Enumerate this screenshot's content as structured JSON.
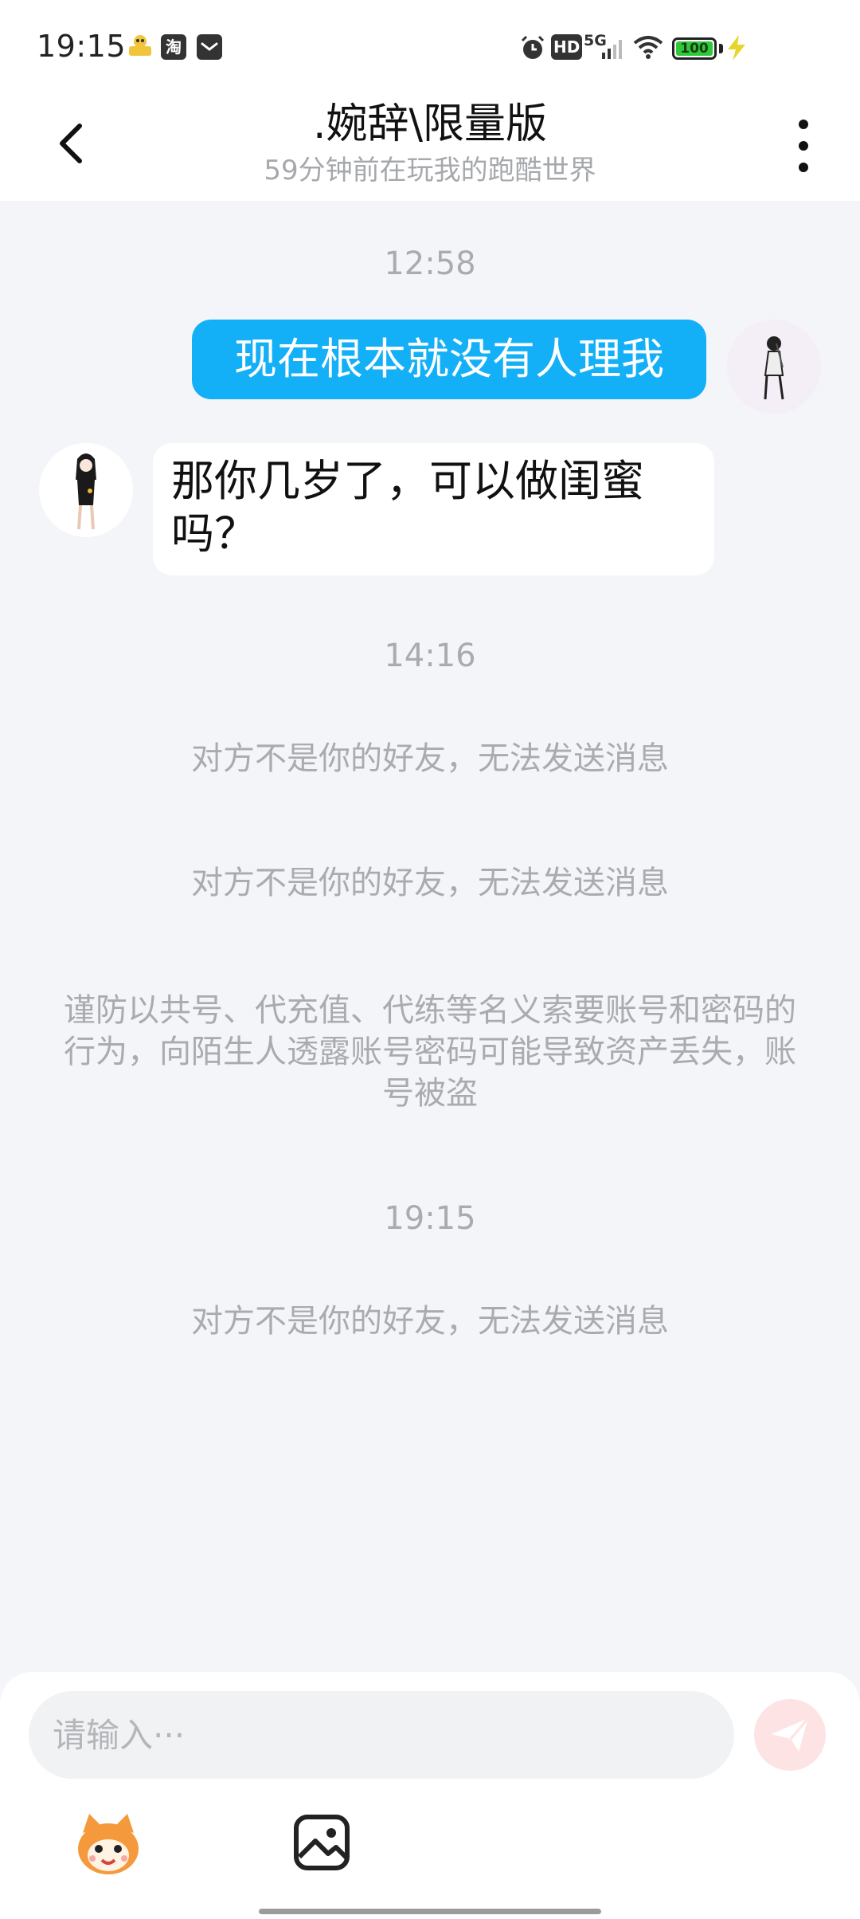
{
  "status_bar": {
    "time": "19:15",
    "network": "5G",
    "battery": "100",
    "icons": [
      "app-mascot-icon",
      "taobao-icon",
      "mail-app-icon",
      "alarm-icon",
      "hd-icon",
      "signal-icon",
      "wifi-icon",
      "battery-icon",
      "charging-icon"
    ]
  },
  "header": {
    "title": ".婉辞\\限量版",
    "subtitle": "59分钟前在玩我的跑酷世界"
  },
  "chat": {
    "time_1": "12:58",
    "outgoing_message": "现在根本就没有人理我",
    "incoming_message": "那你几岁了，可以做闺蜜吗？",
    "time_2": "14:16",
    "system_1": "对方不是你的好友，无法发送消息",
    "system_2": "对方不是你的好友，无法发送消息",
    "warning": "谨防以共号、代充值、代练等名义索要账号和密码的行为，向陌生人透露账号密码可能导致资产丢失，账号被盗",
    "time_3": "19:15",
    "system_3": "对方不是你的好友，无法发送消息"
  },
  "input": {
    "placeholder": "请输入···"
  },
  "colors": {
    "accent_blue": "#14b0f7",
    "send_disabled": "#fde3e4",
    "background": "#f4f5f8"
  }
}
